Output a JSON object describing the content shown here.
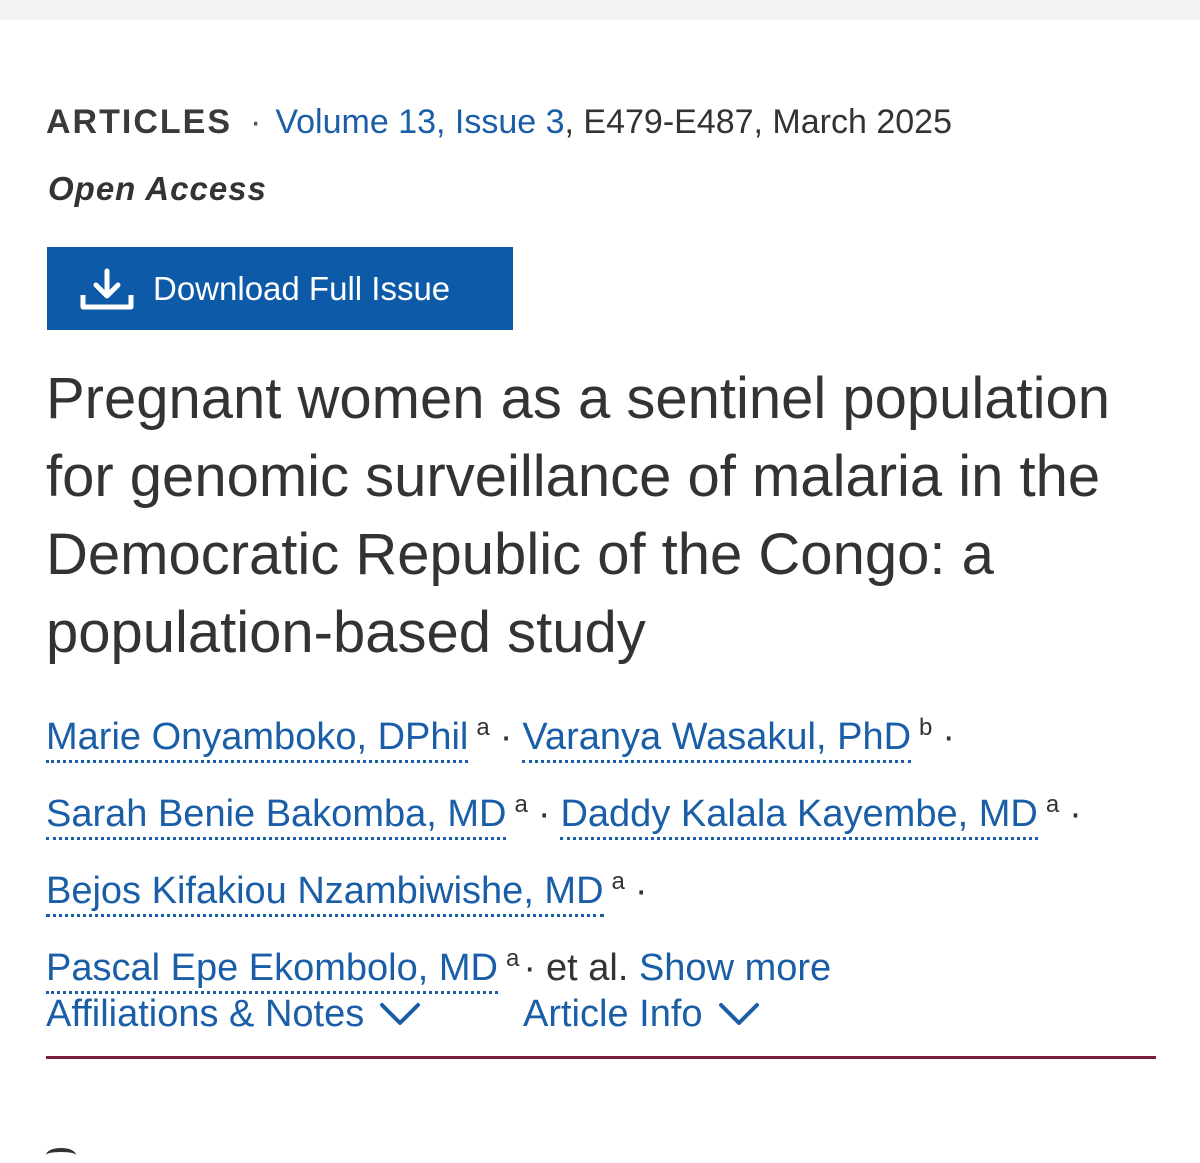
{
  "header": {
    "category": "ARTICLES",
    "separator": "·",
    "volume_issue": "Volume 13, Issue 3",
    "pages_date": ", E479-E487, March 2025",
    "access": "Open Access"
  },
  "download": {
    "label": "Download Full Issue",
    "icon": "download-icon"
  },
  "article": {
    "title": "Pregnant women as a sentinel population for genomic surveillance of malaria in the Democratic Republic of the Congo: a population-based study"
  },
  "authors": {
    "list": [
      {
        "name": "Marie Onyamboko, DPhil",
        "aff": "a"
      },
      {
        "name": "Varanya Wasakul, PhD",
        "aff": "b"
      },
      {
        "name": "Sarah Benie Bakomba, MD",
        "aff": "a"
      },
      {
        "name": "Daddy Kalala Kayembe, MD",
        "aff": "a"
      },
      {
        "name": "Bejos Kifakiou Nzambiwishe, MD",
        "aff": "a"
      },
      {
        "name": "Pascal Epe Ekombolo, MD",
        "aff": "a"
      }
    ],
    "separator": "·",
    "et_al": "et al.",
    "show_more": "Show more"
  },
  "tabs": [
    {
      "label": "Affiliations & Notes",
      "icon": "chevron-down-icon"
    },
    {
      "label": "Article Info",
      "icon": "chevron-down-icon"
    }
  ],
  "colors": {
    "link": "#1a5ea7",
    "button": "#0c5aa8",
    "rule": "#7a1f3d",
    "text": "#333333"
  }
}
